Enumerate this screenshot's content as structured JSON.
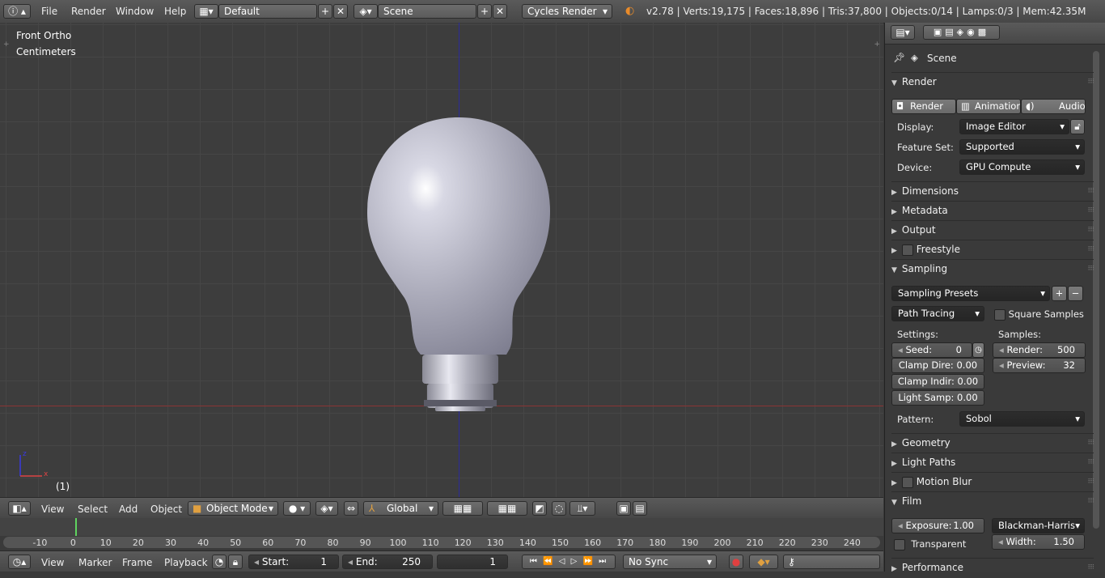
{
  "header": {
    "menus": [
      "File",
      "Render",
      "Window",
      "Help"
    ],
    "layout": "Default",
    "scene": "Scene",
    "engine": "Cycles Render",
    "stats": "v2.78 | Verts:19,175 | Faces:18,896 | Tris:37,800 | Objects:0/14 | Lamps:0/3 | Mem:42.35M"
  },
  "viewport": {
    "view_name": "Front Ortho",
    "units": "Centimeters",
    "frame": "(1)",
    "axis_z": "z",
    "axis_x": "x"
  },
  "view3d_header": {
    "menus": [
      "View",
      "Select",
      "Add",
      "Object"
    ],
    "mode": "Object Mode",
    "orientation": "Global"
  },
  "timeline": {
    "ticks": [
      "-10",
      "0",
      "10",
      "20",
      "30",
      "40",
      "50",
      "60",
      "70",
      "80",
      "90",
      "100",
      "110",
      "120",
      "130",
      "140",
      "150",
      "160",
      "170",
      "180",
      "190",
      "200",
      "210",
      "220",
      "230",
      "240"
    ],
    "menus": [
      "View",
      "Marker",
      "Frame",
      "Playback"
    ],
    "start_label": "Start:",
    "start": "1",
    "end_label": "End:",
    "end": "250",
    "current": "1",
    "sync": "No Sync"
  },
  "properties": {
    "breadcrumb": "Scene",
    "render_panel": "Render",
    "buttons": [
      "Render",
      "Animation",
      "Audio"
    ],
    "display_label": "Display:",
    "display": "Image Editor",
    "feature_label": "Feature Set:",
    "feature": "Supported",
    "device_label": "Device:",
    "device": "GPU Compute",
    "panels_a": [
      "Dimensions",
      "Metadata",
      "Output",
      "Freestyle"
    ],
    "sampling": "Sampling",
    "presets": "Sampling Presets",
    "integrator": "Path Tracing",
    "square_samples": "Square Samples",
    "settings_label": "Settings:",
    "samples_label": "Samples:",
    "seed_label": "Seed:",
    "seed": "0",
    "clamp_direct": "Clamp Dire: 0.00",
    "clamp_indirect": "Clamp Indir: 0.00",
    "light_samp": "Light Samp: 0.00",
    "render_samples_label": "Render:",
    "render_samples": "500",
    "preview_label": "Preview:",
    "preview_samples": "32",
    "pattern_label": "Pattern:",
    "pattern": "Sobol",
    "panels_b": [
      "Geometry",
      "Light Paths",
      "Motion Blur"
    ],
    "film": "Film",
    "exposure_label": "Exposure:",
    "exposure": "1.00",
    "filter": "Blackman-Harris",
    "transparent": "Transparent",
    "width_label": "Width:",
    "width": "1.50",
    "performance": "Performance"
  }
}
